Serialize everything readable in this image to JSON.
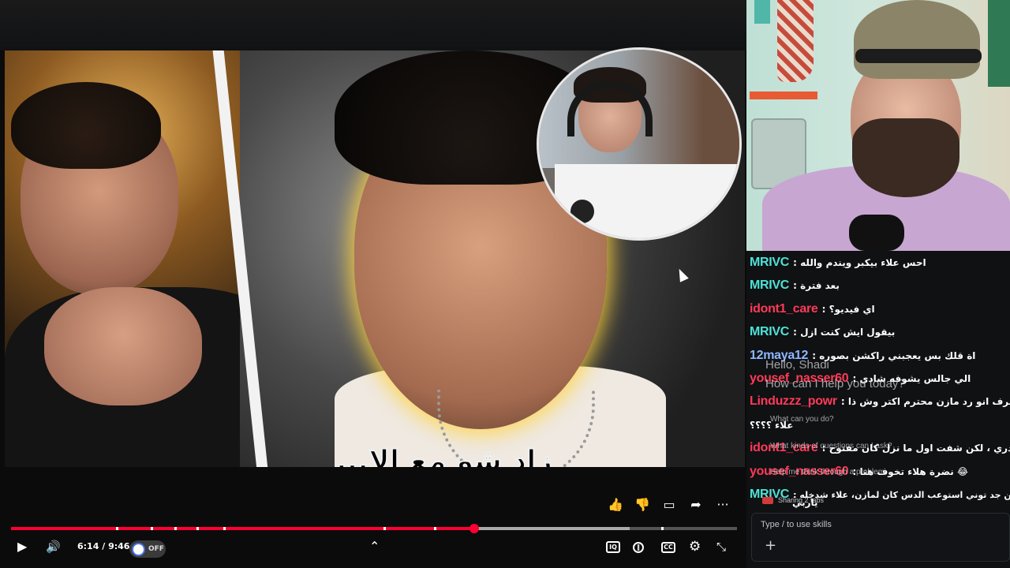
{
  "video": {
    "thumbnail_text": "زاد شو مع الا...",
    "current_time": "6:14",
    "duration": "9:46",
    "progress_fraction": 0.638,
    "buffer_fraction": 0.852,
    "chapter_marks": [
      0.145,
      0.192,
      0.225,
      0.255,
      0.292,
      0.513,
      0.583,
      0.896
    ],
    "autoplay_label": "OFF",
    "actions": [
      {
        "name": "like",
        "glyph": "👍"
      },
      {
        "name": "dislike",
        "glyph": "👎"
      },
      {
        "name": "comment",
        "glyph": "▭"
      },
      {
        "name": "share",
        "glyph": "➦"
      },
      {
        "name": "more",
        "glyph": "···"
      }
    ]
  },
  "controls": {
    "play_glyph": "▶",
    "volume_glyph": "🔊",
    "miniplayer_glyph": "⌃",
    "iq_label": "IQ",
    "cc_label": "CC",
    "settings_glyph": "⚙",
    "fullscreen_glyph": "⤡"
  },
  "chat": {
    "messages": [
      {
        "user": "MRIVC",
        "text": "احس علاء بيكبر ويندم والله",
        "color": "#4fe1d6"
      },
      {
        "user": "MRIVC",
        "text": "بعد فترة",
        "color": "#4fe1d6"
      },
      {
        "user": "idont1_care",
        "text": "اي فيديو؟",
        "color": "#ff3a58"
      },
      {
        "user": "MRIVC",
        "text": "بيقول ايش كنت ازل",
        "color": "#4fe1d6"
      },
      {
        "user": "12maya12",
        "text": "اة قلك بس يعجبني راكشن بصوره",
        "color": "#8fb7ff"
      },
      {
        "user": "yousef_nasser60",
        "text": "الي جالس يشوفه شادي",
        "color": "#ff3a58"
      },
      {
        "user": "Linduzzz_powr",
        "text": "اعترف انو رد مازن محترم اكتر وش ذا",
        "color": "#ff3a58"
      },
      {
        "user": "",
        "text": "علاء ؟؟؟؟",
        "color": "#ffffff"
      },
      {
        "user": "idont1_care",
        "text": "مادري ، لكن شفت اول ما نزل كان مفتوح",
        "color": "#ff3a58"
      },
      {
        "user": "yousef_nasser60",
        "text": "نضرة هلاء تخوف هنا 😂",
        "color": "#ff3a58"
      },
      {
        "user": "MRIVC",
        "text": "من جد توني استوعب الدس كان لمازن، علاء شدخله",
        "color": "#4fe1d6"
      }
    ],
    "tail_text": "ياربي"
  },
  "assistant_overlay": {
    "greeting": "Hello, Shadi",
    "question": "How can I help you today?",
    "hint1": "What can you do?",
    "hint2": "What kinds of questions can I ask?",
    "hint3": "Help me think through a problem",
    "sharing": "Sharing 2 tabs",
    "input_placeholder": "Type / to use skills",
    "add_glyph": "+"
  },
  "colors": {
    "progress": "#ff0033",
    "glow": "#ffd23c"
  }
}
